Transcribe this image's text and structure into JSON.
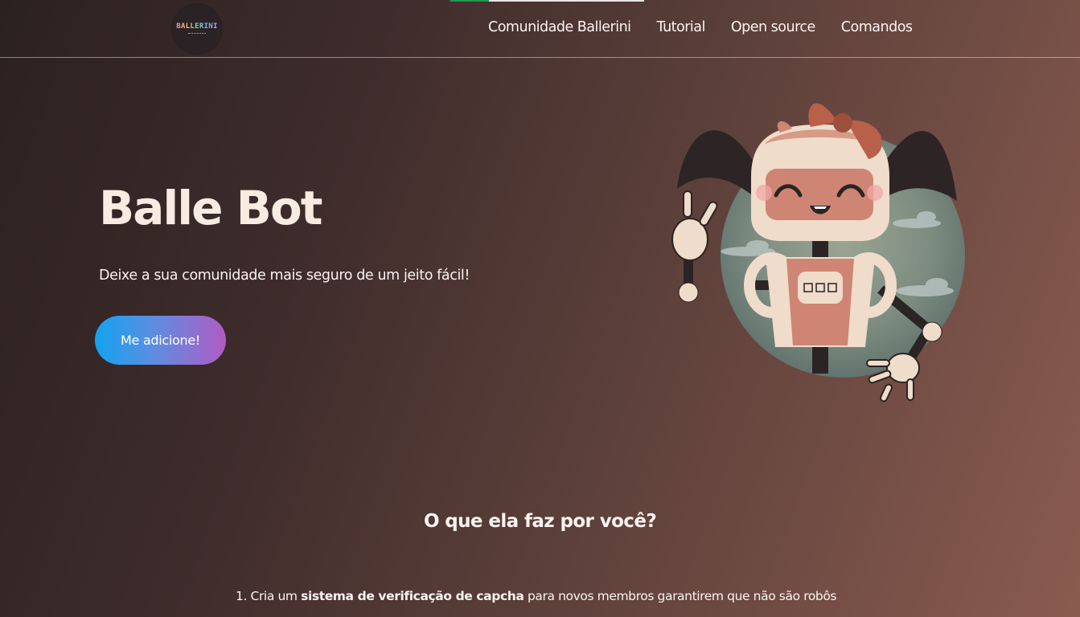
{
  "header": {
    "logo_text": "BALLERINI",
    "progress_percent": 20,
    "nav": [
      {
        "label": "Comunidade Ballerini"
      },
      {
        "label": "Tutorial"
      },
      {
        "label": "Open source"
      },
      {
        "label": "Comandos"
      }
    ]
  },
  "hero": {
    "title": "Balle Bot",
    "subtitle": "Deixe a sua comunidade mais seguro de um jeito fácil!",
    "cta_label": "Me adicione!",
    "illustration_icon": "robot-girl-illustration"
  },
  "features": {
    "heading": "O que ela faz por você?",
    "items": [
      {
        "number": "1.",
        "prefix": "Cria um",
        "bold": "sistema de verificação de capcha",
        "suffix": "para novos membros garantirem que não são robôs"
      }
    ]
  },
  "colors": {
    "accent_progress": "#1e9b4f",
    "button_start": "#12a3ef",
    "button_end": "#b15bc4",
    "background_dark": "#2c2122",
    "background_light": "#8a5b4f"
  }
}
